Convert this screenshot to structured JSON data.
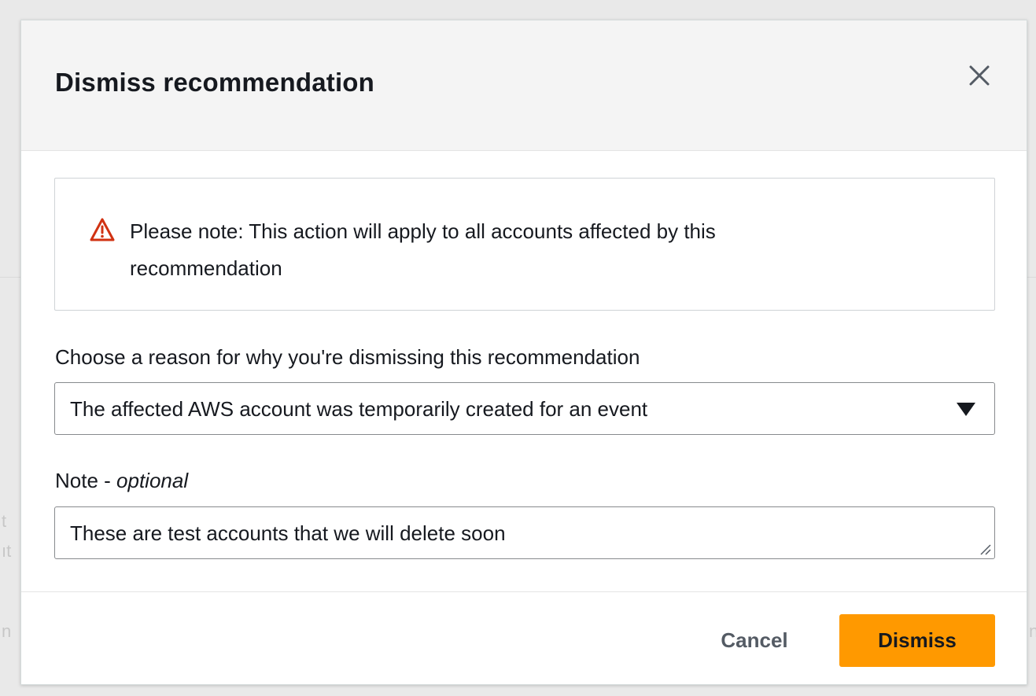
{
  "dialog": {
    "title": "Dismiss recommendation",
    "close_icon": "close-icon"
  },
  "alert": {
    "icon": "warning-icon",
    "icon_color": "#d13212",
    "message": "Please note: This action will apply to all accounts affected by this recommendation"
  },
  "reason": {
    "label": "Choose a reason for why you're dismissing this recommendation",
    "selected": "The affected AWS account was temporarily created for an event",
    "caret_icon": "caret-down-icon"
  },
  "note": {
    "label": "Note - ",
    "label_suffix": "optional",
    "value": "These are test accounts that we will delete soon"
  },
  "footer": {
    "cancel_label": "Cancel",
    "dismiss_label": "Dismiss",
    "primary_color": "#ff9900"
  }
}
